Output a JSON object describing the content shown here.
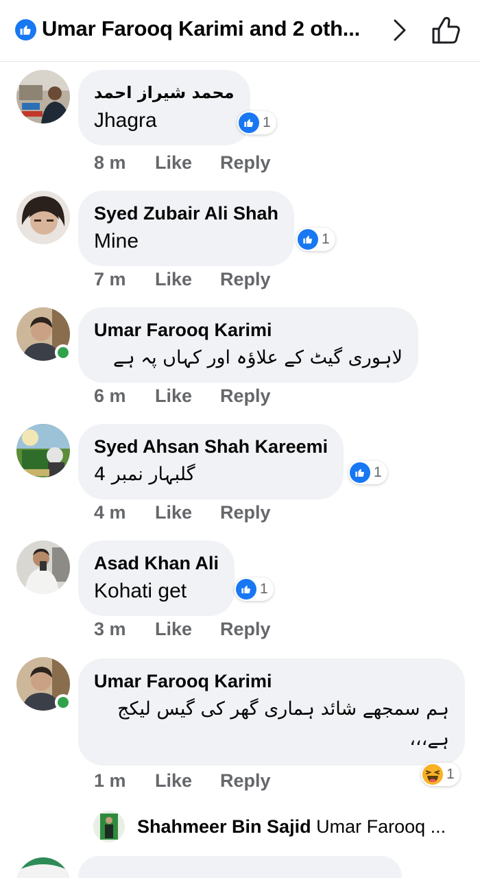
{
  "header": {
    "title": "Umar Farooq Karimi and 2 oth...",
    "like_icon": "like-badge-icon",
    "chevron_icon": "chevron-right-icon",
    "thumb_icon": "thumbs-up-outline-icon"
  },
  "colors": {
    "brand_blue": "#1877f2",
    "bubble_bg": "#f0f2f5",
    "meta_gray": "#65676b",
    "online_green": "#31a24c",
    "haha_yellow": "#f7b125"
  },
  "comments": [
    {
      "author": "محمد شیراز احمد",
      "text": "Jhagra",
      "reaction_type": "like",
      "reaction_count": "1",
      "time": "8 m",
      "like_label": "Like",
      "reply_label": "Reply"
    },
    {
      "author": "Syed Zubair Ali Shah",
      "text": "Mine",
      "reaction_type": "like",
      "reaction_count": "1",
      "time": "7 m",
      "like_label": "Like",
      "reply_label": "Reply"
    },
    {
      "author": "Umar Farooq Karimi",
      "text": "لاہوری گیٹ کے علاؤہ اور کہاں پہ ہے",
      "online": true,
      "time": "6 m",
      "like_label": "Like",
      "reply_label": "Reply"
    },
    {
      "author": "Syed Ahsan Shah Kareemi",
      "text": "گلبہار نمبر 4",
      "reaction_type": "like",
      "reaction_count": "1",
      "time": "4 m",
      "like_label": "Like",
      "reply_label": "Reply"
    },
    {
      "author": "Asad Khan Ali",
      "text": "Kohati get",
      "reaction_type": "like",
      "reaction_count": "1",
      "time": "3 m",
      "like_label": "Like",
      "reply_label": "Reply"
    },
    {
      "author": "Umar Farooq Karimi",
      "text": "ہم سمجھے شائد ہماری گھر کی گیس لیکج ہے،،،",
      "online": true,
      "reaction_type": "haha",
      "reaction_count": "1",
      "time": "1 m",
      "like_label": "Like",
      "reply_label": "Reply"
    }
  ],
  "reply_preview": {
    "author": "Shahmeer Bin Sajid",
    "text": "Umar Farooq ..."
  }
}
